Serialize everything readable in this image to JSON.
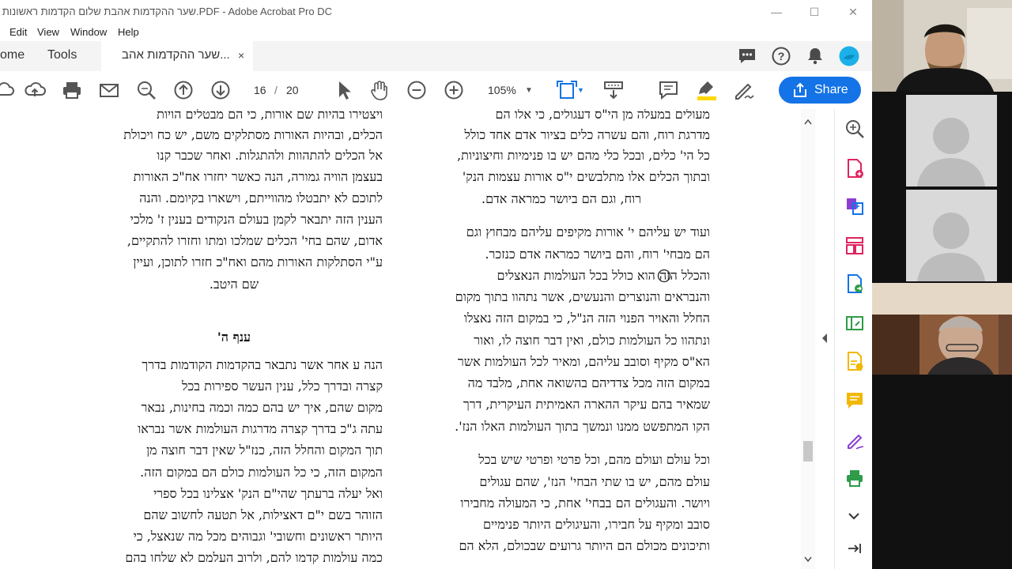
{
  "window": {
    "title": "שער ההקדמות אהבת שלום הקדמות ראשונות.PDF - Adobe Acrobat Pro DC",
    "minimize_icon": "minimize-icon",
    "maximize_icon": "maximize-icon",
    "close_icon": "close-icon"
  },
  "menu": {
    "items": [
      "Edit",
      "View",
      "Window",
      "Help"
    ]
  },
  "tabs": {
    "home": "ome",
    "tools": "Tools",
    "document": "שער ההקדמות אהב...",
    "close": "×"
  },
  "toolbar": {
    "page_current": "16",
    "page_separator": "/",
    "page_total": "20",
    "zoom": "105%",
    "share_label": "Share"
  },
  "document": {
    "left_column": {
      "lines_top": [
        "ויצטירו בהיות שם אורות, כי הם מבטלים הויות",
        "הכלים, ובהיות האורות מסתלקים משם, יש כח ויכולת",
        "אל הכלים להתהוות ולהתגלות. ואחר שכבר קנו",
        "בעצמן הוויה גמורה, הנה כאשר יחזרו אח\"כ האורות",
        "לתוכם לא יתבטלו מהווייתם, וישארו בקיומם. והנה",
        "הענין הזה יתבאר לקמן בעולם הנקודים בענין ז' מלכי",
        "אדום, שהם בחי' הכלים שמלכו ומתו וחזרו להתקיים,",
        "ע\"י הסתלקות האורות מהם ואח\"כ חזרו לתוכן, ועיין",
        "שם היטב."
      ],
      "heading": "ענף ה'",
      "lines_bottom": [
        "הנה ע אחר אשר נתבאר בהקדמות הקודמות בדרך",
        "קצרה ובדרך כלל, ענין העשר ספירות בכל",
        "מקום שהם, איך יש בהם כמה וכמה בחינות, נבאר",
        "עתה ג\"כ בדרך קצרה מדרגות העולמות אשר נבראו",
        "תוך המקום והחלל הזה, כנז\"ל שאין דבר חוצה מן",
        "המקום הזה, כי כל העולמות כולם הם במקום הזה.",
        "ואל יעלה ברעתך שהי\"ם הנק' אצלינו בכל ספרי",
        "הזוהר בשם י\"ם דאצילות, אל תטעה לחשוב שהם",
        "היותר ראשונים וחשובי' וגבוהים מכל מה שנאצל, כי",
        "כמה עולמות קדמו להם, ולרוב העלמם לא שלחו בהם"
      ]
    },
    "right_column": {
      "lines_a": [
        "מעולים במעלה מן הי\"ס דעגולים, כי אלו הם",
        "מדרגת רוח, והם עשרה כלים בציור אדם אחד כולל",
        "כל הי' כלים, ובכל כלי מהם יש בו פנימיות וחיצוניות,",
        "ובתוך הכלים אלו מתלבשים י\"ס אורות עצמות הנק'",
        "רוח, וגם הם ביושר כמראה אדם."
      ],
      "lines_b": [
        "ועוד יש עליהם י' אורות מקיפים עליהם מבחוץ וגם",
        "הם מבחי' רוח, והם ביושר כמראה אדם כנזכר.",
        "והכלל הזה הוא כולל בכל העולמות הנאצלים",
        "והנבראים והנוצרים והנעשים, אשר נתהוו בתוך מקום",
        "החלל והאויר הפנוי הזה הנ\"ל, כי במקום הזה נאצלו",
        "ונתהוו כל העולמות כולם, ואין דבר חוצה לו, ואור",
        "הא\"ס מקיף וסובב עליהם, ומאיר לכל העולמות אשר",
        "במקום הזה מכל צדדיהם בהשואה אחת, מלבד מה",
        "שמאיר בהם עיקר ההארה האמיתית העיקרית, דרך",
        "הקו המתפשט ממנו ונמשך בתוך העולמות האלו הנז'."
      ],
      "lines_c": [
        "וכל עולם ועולם מהם, וכל פרטי ופרטי שיש בכל",
        "עולם מהם, יש בו שתי הבחי' הנז', שהם עגולים",
        "ויושר. והעגולים הם בבחי' אחת, כי המעולה מחבירו",
        "סובב ומקיף על חבירו, והעיגולים היותר פנימיים",
        "ותיכונים מכולם הם היותר גרועים שבכולם, הלא הם"
      ]
    }
  },
  "colors": {
    "accent": "#1473e6",
    "tool_pink": "#e0245e",
    "tool_purple": "#8b3fd1",
    "tool_green": "#2e9c48",
    "tool_yellow": "#f2b705",
    "highlighter": "#ffd800"
  },
  "video": {
    "participants": [
      {
        "name": "participant-1",
        "state": "camera-on"
      },
      {
        "name": "participant-2",
        "state": "camera-off"
      },
      {
        "name": "participant-3",
        "state": "camera-off"
      },
      {
        "name": "participant-4",
        "state": "camera-on"
      }
    ]
  }
}
